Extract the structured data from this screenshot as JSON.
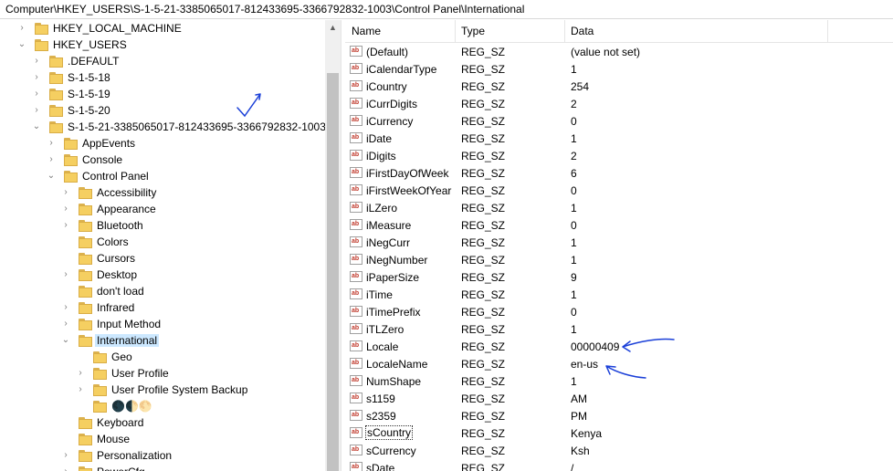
{
  "address": "Computer\\HKEY_USERS\\S-1-5-21-3385065017-812433695-3366792832-1003\\Control Panel\\International",
  "tree": [
    {
      "label": "HKEY_LOCAL_MACHINE",
      "expander": "right"
    },
    {
      "label": "HKEY_USERS",
      "expander": "down"
    },
    {
      "label": ".DEFAULT",
      "expander": "right"
    },
    {
      "label": "S-1-5-18",
      "expander": "right"
    },
    {
      "label": "S-1-5-19",
      "expander": "right"
    },
    {
      "label": "S-1-5-20",
      "expander": "right"
    },
    {
      "label": "S-1-5-21-3385065017-812433695-3366792832-1003",
      "expander": "down"
    },
    {
      "label": "AppEvents",
      "expander": "right"
    },
    {
      "label": "Console",
      "expander": "right"
    },
    {
      "label": "Control Panel",
      "expander": "down"
    },
    {
      "label": "Accessibility",
      "expander": "right"
    },
    {
      "label": "Appearance",
      "expander": "right"
    },
    {
      "label": "Bluetooth",
      "expander": "right"
    },
    {
      "label": "Colors",
      "expander": "none"
    },
    {
      "label": "Cursors",
      "expander": "none"
    },
    {
      "label": "Desktop",
      "expander": "right"
    },
    {
      "label": "don't load",
      "expander": "none"
    },
    {
      "label": "Infrared",
      "expander": "right"
    },
    {
      "label": "Input Method",
      "expander": "right"
    },
    {
      "label": "International",
      "expander": "down",
      "selected": true
    },
    {
      "label": "Geo",
      "expander": "none"
    },
    {
      "label": "User Profile",
      "expander": "right"
    },
    {
      "label": "User Profile System Backup",
      "expander": "right"
    },
    {
      "label": "🌑🌓🌕",
      "expander": "none"
    },
    {
      "label": "Keyboard",
      "expander": "none"
    },
    {
      "label": "Mouse",
      "expander": "none"
    },
    {
      "label": "Personalization",
      "expander": "right"
    },
    {
      "label": "PowerCfg",
      "expander": "right"
    }
  ],
  "list": {
    "headers": {
      "name": "Name",
      "type": "Type",
      "data": "Data"
    },
    "icon_text": "ab",
    "rows": [
      {
        "name": "(Default)",
        "type": "REG_SZ",
        "data": "(value not set)"
      },
      {
        "name": "iCalendarType",
        "type": "REG_SZ",
        "data": "1"
      },
      {
        "name": "iCountry",
        "type": "REG_SZ",
        "data": "254"
      },
      {
        "name": "iCurrDigits",
        "type": "REG_SZ",
        "data": "2"
      },
      {
        "name": "iCurrency",
        "type": "REG_SZ",
        "data": "0"
      },
      {
        "name": "iDate",
        "type": "REG_SZ",
        "data": "1"
      },
      {
        "name": "iDigits",
        "type": "REG_SZ",
        "data": "2"
      },
      {
        "name": "iFirstDayOfWeek",
        "type": "REG_SZ",
        "data": "6"
      },
      {
        "name": "iFirstWeekOfYear",
        "type": "REG_SZ",
        "data": "0"
      },
      {
        "name": "iLZero",
        "type": "REG_SZ",
        "data": "1"
      },
      {
        "name": "iMeasure",
        "type": "REG_SZ",
        "data": "0"
      },
      {
        "name": "iNegCurr",
        "type": "REG_SZ",
        "data": "1"
      },
      {
        "name": "iNegNumber",
        "type": "REG_SZ",
        "data": "1"
      },
      {
        "name": "iPaperSize",
        "type": "REG_SZ",
        "data": "9"
      },
      {
        "name": "iTime",
        "type": "REG_SZ",
        "data": "1"
      },
      {
        "name": "iTimePrefix",
        "type": "REG_SZ",
        "data": "0"
      },
      {
        "name": "iTLZero",
        "type": "REG_SZ",
        "data": "1"
      },
      {
        "name": "Locale",
        "type": "REG_SZ",
        "data": "00000409"
      },
      {
        "name": "LocaleName",
        "type": "REG_SZ",
        "data": "en-us"
      },
      {
        "name": "NumShape",
        "type": "REG_SZ",
        "data": "1"
      },
      {
        "name": "s1159",
        "type": "REG_SZ",
        "data": "AM"
      },
      {
        "name": "s2359",
        "type": "REG_SZ",
        "data": "PM"
      },
      {
        "name": "sCountry",
        "type": "REG_SZ",
        "data": "Kenya",
        "focused": true
      },
      {
        "name": "sCurrency",
        "type": "REG_SZ",
        "data": "Ksh"
      },
      {
        "name": "sDate",
        "type": "REG_SZ",
        "data": "/"
      }
    ]
  },
  "colors": {
    "annotation": "#1a3fd8",
    "selection": "#cce8ff",
    "folder": "#f5cf61"
  }
}
